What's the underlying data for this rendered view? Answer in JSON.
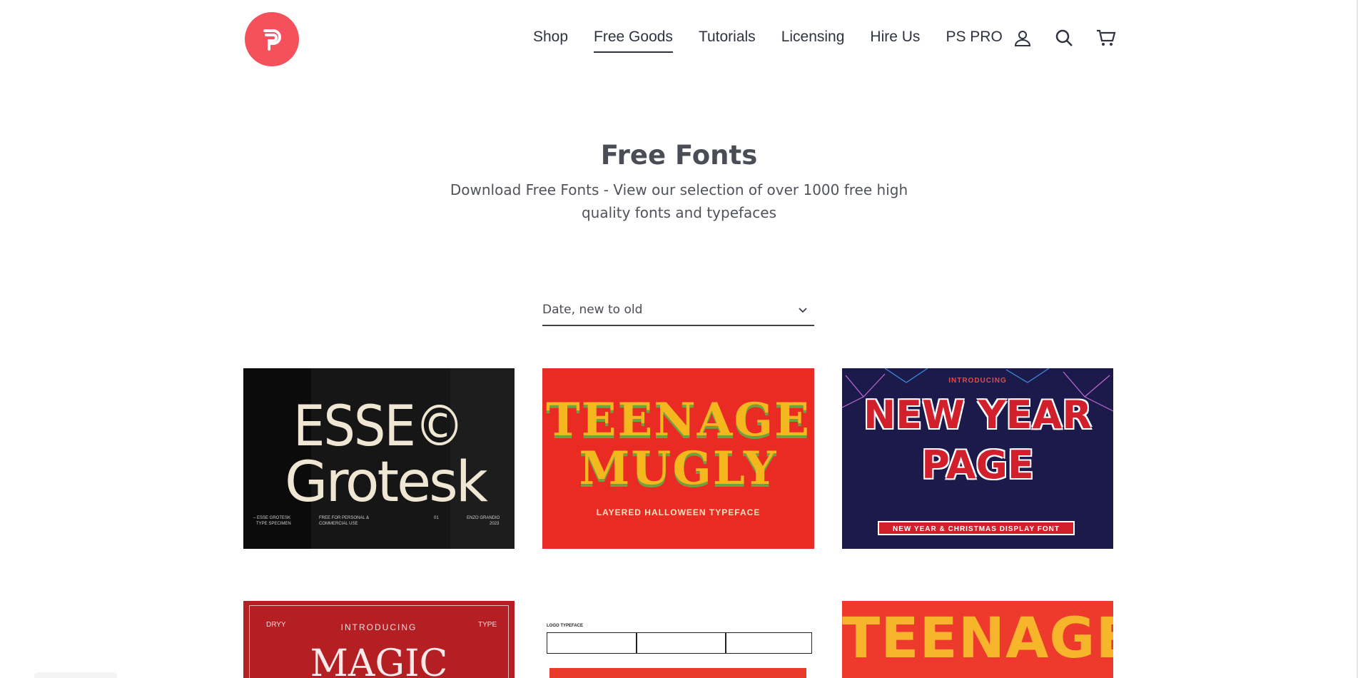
{
  "header": {
    "nav": [
      "Shop",
      "Free Goods",
      "Tutorials",
      "Licensing",
      "Hire Us",
      "PS PRO"
    ],
    "active_nav": "Free Goods"
  },
  "icons": [
    "logo-icon",
    "account-icon",
    "search-icon",
    "cart-icon",
    "chevron-down-icon"
  ],
  "page": {
    "title": "Free Fonts",
    "subtitle": "Download Free Fonts - View our selection of over 1000 free high quality fonts and typefaces"
  },
  "sort": {
    "selected": "Date, new to old"
  },
  "products": [
    {
      "headline1": "ESSE©",
      "headline2": "Grotesk",
      "details": [
        "– ESSE GROTESK",
        "TYPE SPECIMEN",
        "FREE FOR PERSONAL &",
        "COMMERCIAL USE",
        "01",
        "ENZO GRANDIO",
        "2023"
      ]
    },
    {
      "headline1": "TEENAGE",
      "headline2": "MUGLY",
      "details": [
        "LAYERED HALLOWEEN TYPEFACE"
      ]
    },
    {
      "headline1": "NEW YEAR",
      "headline2": "PAGE",
      "details": [
        "INTRODUCING",
        "NEW YEAR & CHRISTMAS DISPLAY FONT"
      ]
    },
    {
      "headline1": "MAGIC",
      "details": [
        "INTRODUCING",
        "DRYY",
        "TYPE"
      ]
    },
    {
      "headline1": "",
      "details": [
        "LOGO TYPEFACE"
      ]
    },
    {
      "headline1": "TEENAGE",
      "details": []
    }
  ],
  "colors": {
    "logo": "#f5505c",
    "text": "#2f3340"
  }
}
